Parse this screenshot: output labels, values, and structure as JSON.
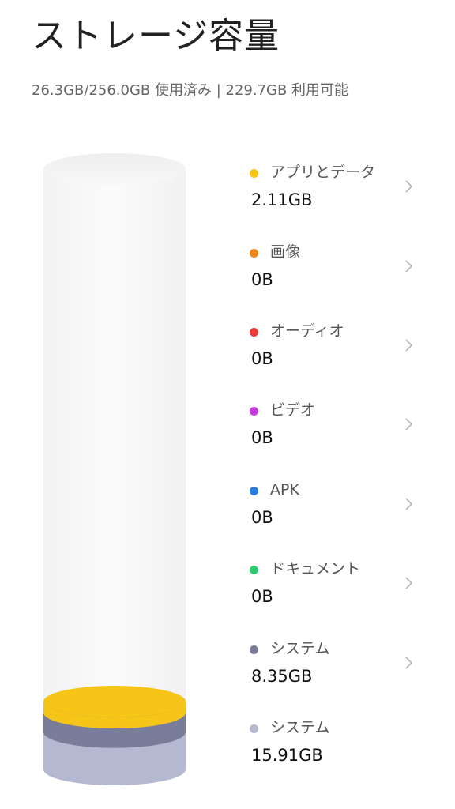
{
  "header": {
    "title": "ストレージ容量",
    "summary": "26.3GB/256.0GB 使用済み | 229.7GB 利用可能"
  },
  "categories": [
    {
      "label": "アプリとデータ",
      "size": "2.11GB",
      "color": "#f5c518",
      "icon": "chevron-right-icon"
    },
    {
      "label": "画像",
      "size": "0B",
      "color": "#f2871f",
      "icon": "chevron-right-icon"
    },
    {
      "label": "オーディオ",
      "size": "0B",
      "color": "#ee3b3b",
      "icon": "chevron-right-icon"
    },
    {
      "label": "ビデオ",
      "size": "0B",
      "color": "#c53be0",
      "icon": "chevron-right-icon"
    },
    {
      "label": "APK",
      "size": "0B",
      "color": "#2a7de1",
      "icon": "chevron-right-icon"
    },
    {
      "label": "ドキュメント",
      "size": "0B",
      "color": "#2ecc71",
      "icon": "chevron-right-icon"
    },
    {
      "label": "システム",
      "size": "8.35GB",
      "color": "#7a7d99",
      "icon": "chevron-right-icon"
    },
    {
      "label": "システム",
      "size": "15.91GB",
      "color": "#b4b8d0",
      "icon": ""
    }
  ],
  "chart_data": {
    "type": "bar",
    "title": "",
    "unit": "GB",
    "total": 256.0,
    "used": 26.3,
    "available": 229.7,
    "categories": [
      "アプリとデータ",
      "画像",
      "オーディオ",
      "ビデオ",
      "APK",
      "ドキュメント",
      "システム",
      "システム"
    ],
    "values": [
      2.11,
      0,
      0,
      0,
      0,
      0,
      8.35,
      15.91
    ],
    "colors": [
      "#f5c518",
      "#f2871f",
      "#ee3b3b",
      "#c53be0",
      "#2a7de1",
      "#2ecc71",
      "#7a7d99",
      "#b4b8d0"
    ],
    "stacked": true
  }
}
